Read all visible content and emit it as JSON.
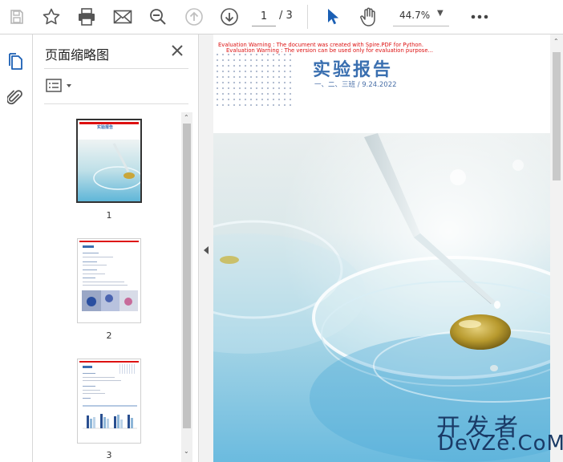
{
  "toolbar": {
    "page_current": "1",
    "page_total": "/ 3",
    "zoom": "44.7%"
  },
  "panel": {
    "title": "页面缩略图",
    "thumbnails": [
      {
        "label": "1"
      },
      {
        "label": "2"
      },
      {
        "label": "3"
      }
    ]
  },
  "document": {
    "warning_line1": "Evaluation Warning : The document was created with Spire.PDF for Python.",
    "warning_line2": "Evaluation Warning : The version can be used only for evaluation purpose...",
    "report_title": "实验报告",
    "report_subtitle": "一、二、三班  /  9.24.2022",
    "thumb_title": "实验报告"
  },
  "watermark": {
    "line1": "开发者",
    "line2": "DevZe.CoM"
  },
  "colors": {
    "accent": "#3a6fb0",
    "warning": "#dd1111",
    "selection": "#1a5fb4"
  }
}
